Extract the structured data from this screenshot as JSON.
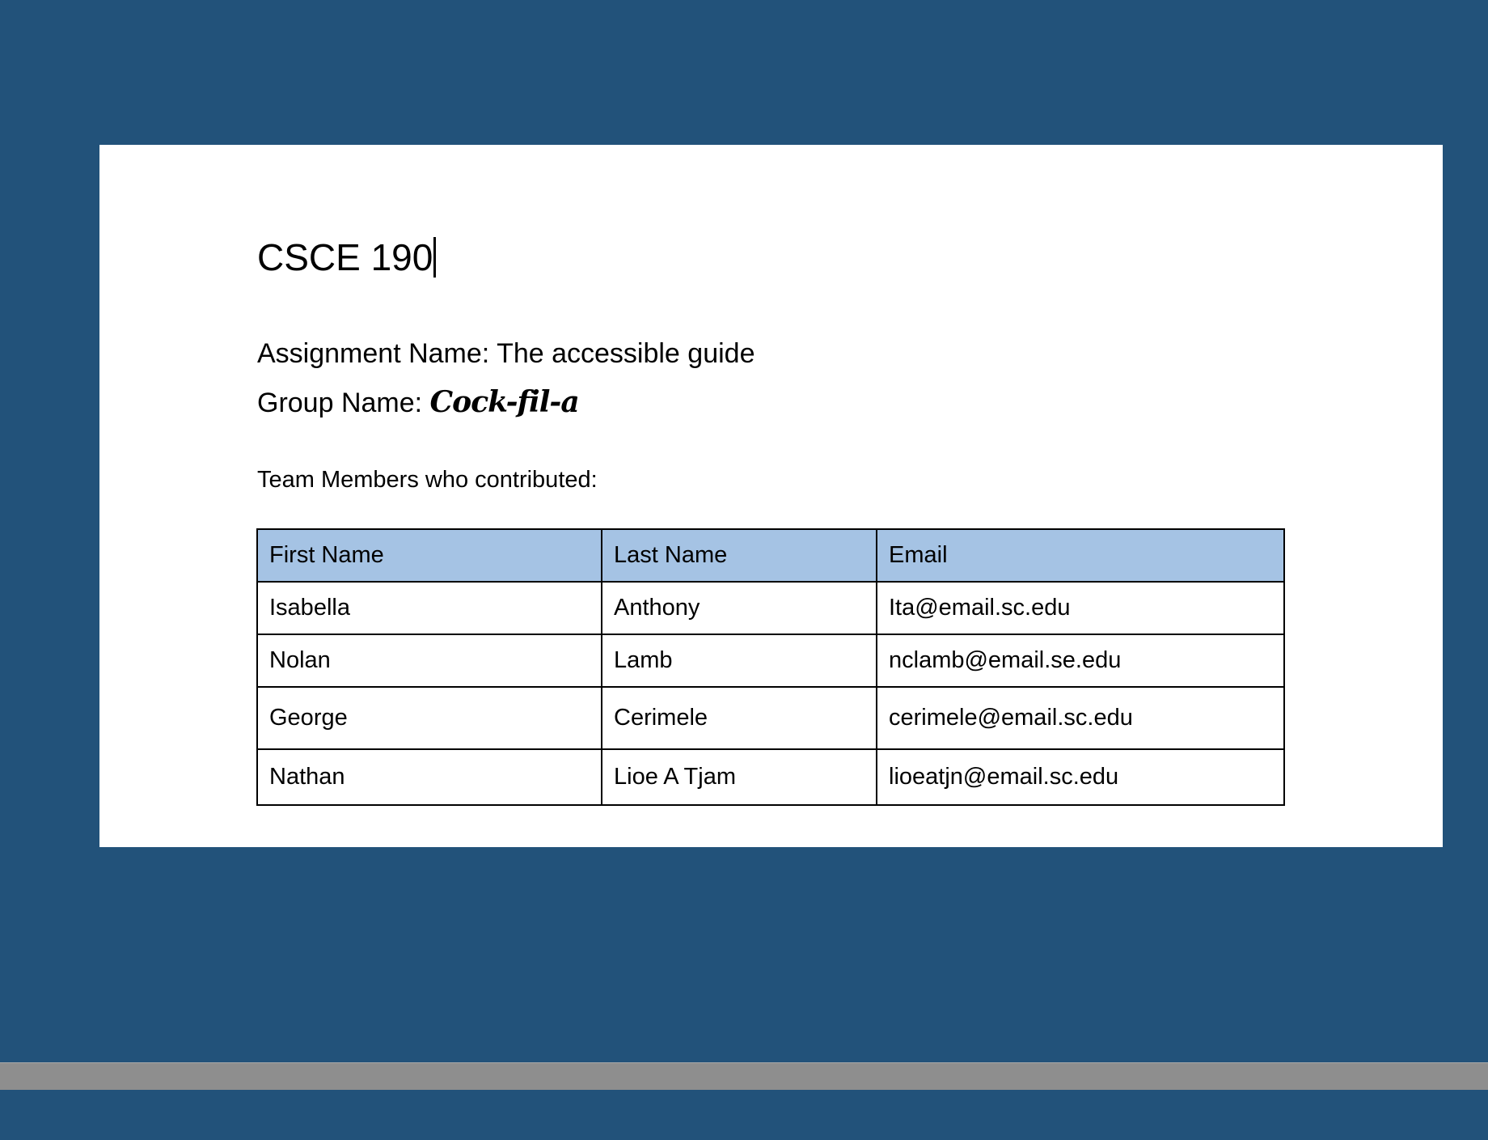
{
  "document": {
    "title": "CSCE 190",
    "assignment_prefix": "Assignment Name: ",
    "assignment_name": "The accessible guide",
    "group_prefix": "Group Name: ",
    "group_name": "Cock-fil-a",
    "team_label": "Team Members who contributed:"
  },
  "table": {
    "headers": [
      "First Name",
      "Last Name",
      "Email"
    ],
    "rows": [
      [
        "Isabella",
        "Anthony",
        "Ita@email.sc.edu"
      ],
      [
        "Nolan",
        "Lamb",
        "nclamb@email.se.edu"
      ],
      [
        "George",
        "Cerimele",
        "cerimele@email.sc.edu"
      ],
      [
        "Nathan",
        "Lioe A Tjam",
        "lioeatjn@email.sc.edu"
      ]
    ]
  },
  "colors": {
    "background": "#22527a",
    "page": "#ffffff",
    "header_fill": "#a5c3e4",
    "scrollbar": "#8e8e8e"
  }
}
